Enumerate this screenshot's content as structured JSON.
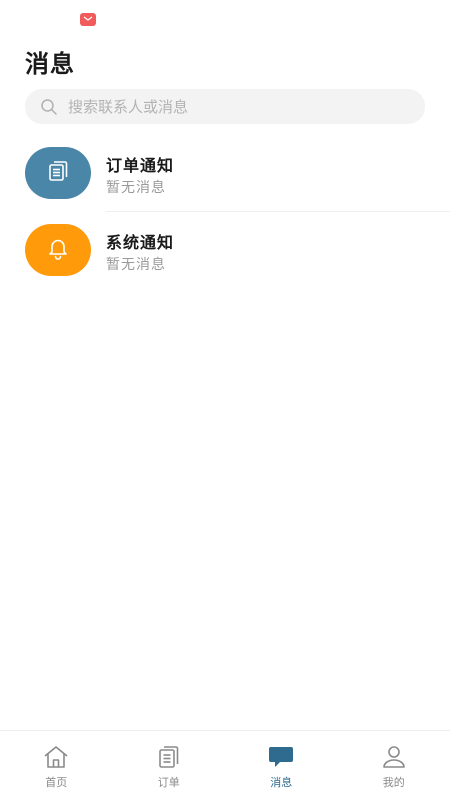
{
  "header": {
    "title": "消息"
  },
  "search": {
    "placeholder": "搜索联系人或消息"
  },
  "messages": [
    {
      "title": "订单通知",
      "subtitle": "暂无消息",
      "icon": "clipboard-icon",
      "color": "#4a86a8"
    },
    {
      "title": "系统通知",
      "subtitle": "暂无消息",
      "icon": "bell-icon",
      "color": "#ff9a0a"
    }
  ],
  "tabs": [
    {
      "label": "首页",
      "icon": "home-icon",
      "active": false
    },
    {
      "label": "订单",
      "icon": "order-icon",
      "active": false
    },
    {
      "label": "消息",
      "icon": "message-icon",
      "active": true
    },
    {
      "label": "我的",
      "icon": "user-icon",
      "active": false
    }
  ],
  "colors": {
    "accent": "#2e6b8f",
    "order_avatar": "#4a86a8",
    "system_avatar": "#ff9a0a",
    "status_app_icon": "#f25b5b"
  }
}
